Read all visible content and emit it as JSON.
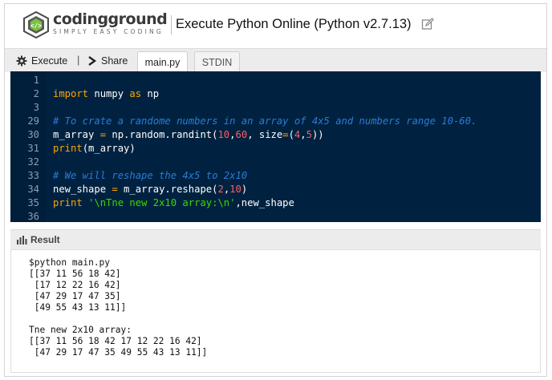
{
  "header": {
    "brand_name": "codingground",
    "brand_tagline": "SIMPLY EASY CODING",
    "title": "Execute Python Online (Python v2.7.13)"
  },
  "toolbar": {
    "execute_label": "Execute",
    "separator": "|",
    "share_label": "Share",
    "tabs": [
      {
        "label": "main.py",
        "active": true
      },
      {
        "label": "STDIN",
        "active": false
      }
    ]
  },
  "editor": {
    "lines": [
      {
        "num": "1",
        "tokens": []
      },
      {
        "num": "2",
        "tokens": [
          {
            "t": "kw",
            "v": "import"
          },
          {
            "t": "tx",
            "v": " numpy "
          },
          {
            "t": "kw",
            "v": "as"
          },
          {
            "t": "tx",
            "v": " np"
          }
        ]
      },
      {
        "num": "3",
        "tokens": []
      },
      {
        "num": "29",
        "tokens": [
          {
            "t": "cm",
            "v": "# To crate a randome numbers in an array of 4x5 and numbers range 10-60."
          }
        ]
      },
      {
        "num": "30",
        "tokens": [
          {
            "t": "tx",
            "v": "m_array "
          },
          {
            "t": "kw",
            "v": "="
          },
          {
            "t": "tx",
            "v": " np.random.randint("
          },
          {
            "t": "num",
            "v": "10"
          },
          {
            "t": "tx",
            "v": ","
          },
          {
            "t": "num",
            "v": "60"
          },
          {
            "t": "tx",
            "v": ", size"
          },
          {
            "t": "kw",
            "v": "="
          },
          {
            "t": "tx",
            "v": "("
          },
          {
            "t": "num",
            "v": "4"
          },
          {
            "t": "tx",
            "v": ","
          },
          {
            "t": "num",
            "v": "5"
          },
          {
            "t": "tx",
            "v": "))"
          }
        ]
      },
      {
        "num": "31",
        "tokens": [
          {
            "t": "kw",
            "v": "print"
          },
          {
            "t": "tx",
            "v": "(m_array)"
          }
        ]
      },
      {
        "num": "32",
        "tokens": []
      },
      {
        "num": "33",
        "tokens": [
          {
            "t": "cm",
            "v": "# We will reshape the 4x5 to 2x10"
          }
        ]
      },
      {
        "num": "34",
        "tokens": [
          {
            "t": "tx",
            "v": "new_shape "
          },
          {
            "t": "kw",
            "v": "="
          },
          {
            "t": "tx",
            "v": " m_array.reshape("
          },
          {
            "t": "num",
            "v": "2"
          },
          {
            "t": "tx",
            "v": ","
          },
          {
            "t": "num",
            "v": "10"
          },
          {
            "t": "tx",
            "v": ")"
          }
        ]
      },
      {
        "num": "35",
        "tokens": [
          {
            "t": "kw",
            "v": "print"
          },
          {
            "t": "tx",
            "v": " "
          },
          {
            "t": "str",
            "v": "'\\nTne new 2x10 array:\\n'"
          },
          {
            "t": "tx",
            "v": ",new_shape"
          }
        ]
      },
      {
        "num": "36",
        "tokens": []
      }
    ]
  },
  "result": {
    "label": "Result",
    "lines": [
      "$python main.py",
      "[[37 11 56 18 42]",
      " [17 12 22 16 42]",
      " [47 29 17 47 35]",
      " [49 55 43 13 11]]",
      "",
      "Tne new 2x10 array:",
      "[[37 11 56 18 42 17 12 22 16 42]",
      " [47 29 17 47 35 49 55 43 13 11]]"
    ]
  },
  "colors": {
    "editor_bg": "#002240",
    "keyword": "#ffa500",
    "comment": "#2a7bd8",
    "number": "#ff5d5d",
    "string": "#3ad900"
  },
  "icons": [
    "gear-icon",
    "share-icon",
    "edit-icon",
    "bar-chart-icon"
  ]
}
